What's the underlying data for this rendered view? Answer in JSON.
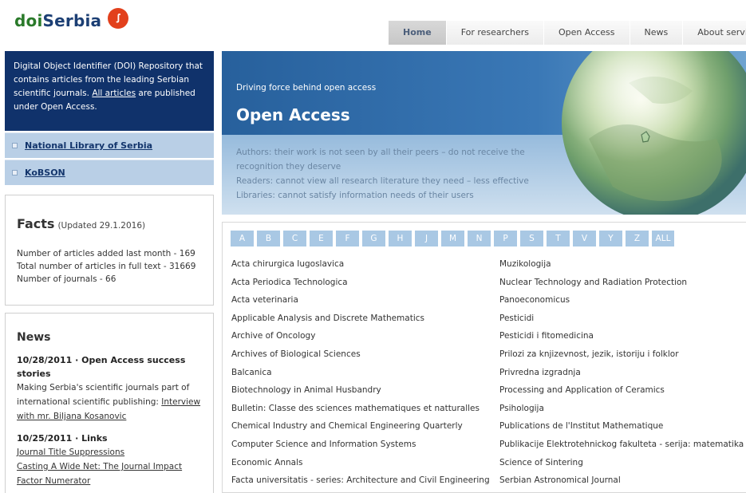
{
  "header": {
    "logo_doi": "doi",
    "logo_serbia": "Serbia",
    "nav": [
      {
        "label": "Home",
        "active": true
      },
      {
        "label": "For researchers",
        "active": false
      },
      {
        "label": "Open Access",
        "active": false
      },
      {
        "label": "News",
        "active": false
      },
      {
        "label": "About service",
        "active": false
      }
    ]
  },
  "sidebar": {
    "intro_pre": "Digital Object Identifier (DOI) Repository that contains articles from the leading Serbian scientific journals. ",
    "intro_link": "All articles",
    "intro_post": " are published under Open Access.",
    "links": [
      {
        "first": "N",
        "rest": "ational Library of Serbia"
      },
      {
        "first": "K",
        "rest": "oBSON"
      }
    ]
  },
  "facts": {
    "title": "Facts",
    "updated": "(Updated 29.1.2016)",
    "lines": [
      "Number of articles added last month - 169",
      "Total number of articles in full text - 31669",
      "Number of journals - 66"
    ]
  },
  "news": {
    "title": "News",
    "item1_title": "10/28/2011 · Open Access success stories",
    "item1_text": "Making Serbia's scientific journals part of international scientific publishing: ",
    "item1_link": "Interview with mr. Biljana Kosanovic",
    "item2_title": "10/25/2011 · Links",
    "item2_link1": "Journal Title Suppressions",
    "item2_link2": "Casting A Wide Net: The Journal Impact Factor Numerator"
  },
  "banner": {
    "tagline": "Driving force behind open access",
    "title": "Open Access",
    "desc1": "Authors: their work is not seen by all their peers – do not receive the recognition they deserve",
    "desc2": "Readers: cannot view all research literature they need – less effective",
    "desc3": "Libraries: cannot satisfy information needs of their users"
  },
  "alphabet": [
    "A",
    "B",
    "C",
    "E",
    "F",
    "G",
    "H",
    "J",
    "M",
    "N",
    "P",
    "S",
    "T",
    "V",
    "Y",
    "Z",
    "ALL"
  ],
  "journals_left": [
    "Acta chirurgica Iugoslavica",
    "Acta Periodica Technologica",
    "Acta veterinaria",
    "Applicable Analysis and Discrete Mathematics",
    "Archive of Oncology",
    "Archives of Biological Sciences",
    "Balcanica",
    "Biotechnology in Animal Husbandry",
    "Bulletin: Classe des sciences mathematiques et natturalles",
    "Chemical Industry and Chemical Engineering Quarterly",
    "Computer Science and Information Systems",
    "Economic Annals",
    "Facta universitatis - series: Architecture and Civil Engineering"
  ],
  "journals_right": [
    "Muzikologija",
    "Nuclear Technology and Radiation Protection",
    "Panoeconomicus",
    "Pesticidi",
    "Pesticidi i fitomedicina",
    "Prilozi za knjizevnost, jezik, istoriju i folklor",
    "Privredna izgradnja",
    "Processing and Application of Ceramics",
    "Psihologija",
    "Publications de l'Institut Mathematique",
    "Publikacije Elektrotehnickog fakulteta - serija: matematika",
    "Science of Sintering",
    "Serbian Astronomical Journal"
  ],
  "colors": {
    "navy": "#10326b",
    "side_link_bg": "#b9cfe6",
    "letter_bg": "#a9c8e4",
    "logo_badge": "#e2401c"
  },
  "icons": [
    "stumbleupon-logo-icon",
    "square-bullet-icon",
    "globe-icon"
  ]
}
